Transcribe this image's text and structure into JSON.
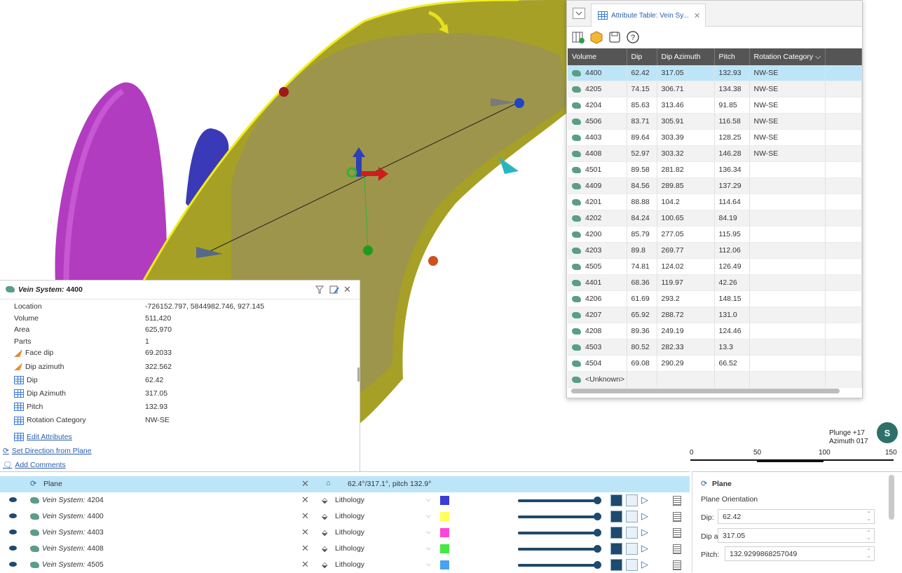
{
  "viewport": {
    "plunge_label": "Plunge +17",
    "azimuth_label": "Azimuth 017",
    "compass_letter": "S",
    "scale_ticks": [
      "0",
      "50",
      "100",
      "150"
    ]
  },
  "attribute_table": {
    "tab_title": "Attribute Table: Vein Sy...",
    "columns": [
      "Volume",
      "Dip",
      "Dip Azimuth",
      "Pitch",
      "Rotation Category"
    ],
    "rows": [
      [
        "4400",
        "62.42",
        "317.05",
        "132.93",
        "NW-SE"
      ],
      [
        "4205",
        "74.15",
        "306.71",
        "134.38",
        "NW-SE"
      ],
      [
        "4204",
        "85.63",
        "313.46",
        "91.85",
        "NW-SE"
      ],
      [
        "4506",
        "83.71",
        "305.91",
        "116.58",
        "NW-SE"
      ],
      [
        "4403",
        "89.64",
        "303.39",
        "128.25",
        "NW-SE"
      ],
      [
        "4408",
        "52.97",
        "303.32",
        "146.28",
        "NW-SE"
      ],
      [
        "4501",
        "89.58",
        "281.82",
        "136.34",
        ""
      ],
      [
        "4409",
        "84.56",
        "289.85",
        "137.29",
        ""
      ],
      [
        "4201",
        "88.88",
        "104.2",
        "114.64",
        ""
      ],
      [
        "4202",
        "84.24",
        "100.65",
        "84.19",
        ""
      ],
      [
        "4200",
        "85.79",
        "277.05",
        "115.95",
        ""
      ],
      [
        "4203",
        "89.8",
        "269.77",
        "112.06",
        ""
      ],
      [
        "4505",
        "74.81",
        "124.02",
        "126.49",
        ""
      ],
      [
        "4401",
        "68.36",
        "119.97",
        "42.26",
        ""
      ],
      [
        "4206",
        "61.69",
        "293.2",
        "148.15",
        ""
      ],
      [
        "4207",
        "65.92",
        "288.72",
        "131.0",
        ""
      ],
      [
        "4208",
        "89.36",
        "249.19",
        "124.46",
        ""
      ],
      [
        "4503",
        "80.52",
        "282.33",
        "13.3",
        ""
      ],
      [
        "4504",
        "69.08",
        "290.29",
        "66.52",
        ""
      ],
      [
        "<Unknown>",
        "",
        "",
        "",
        ""
      ]
    ]
  },
  "properties": {
    "title_prefix": "Vein System:",
    "title_id": "4400",
    "fields": [
      {
        "label": "Location",
        "value": "-726152.797, 5844982.746, 927.145",
        "icon": ""
      },
      {
        "label": "Volume",
        "value": "511,420",
        "icon": ""
      },
      {
        "label": "Area",
        "value": "625,970",
        "icon": ""
      },
      {
        "label": "Parts",
        "value": "1",
        "icon": ""
      },
      {
        "label": "Face dip",
        "value": "69.2033",
        "icon": "dip-icon"
      },
      {
        "label": "Dip azimuth",
        "value": "322.562",
        "icon": "dip-icon"
      },
      {
        "label": "Dip",
        "value": "62.42",
        "icon": "table-icon"
      },
      {
        "label": "Dip Azimuth",
        "value": "317.05",
        "icon": "table-icon"
      },
      {
        "label": "Pitch",
        "value": "132.93",
        "icon": "table-icon"
      },
      {
        "label": "Rotation Category",
        "value": "NW-SE",
        "icon": "table-icon"
      }
    ],
    "links": {
      "edit": "Edit Attributes",
      "set_direction": "Set Direction from Plane",
      "add_comments": "Add Comments"
    }
  },
  "scene_list": {
    "header": {
      "name": "Plane",
      "orientation": "62.4°/317.1°, pitch 132.9°"
    },
    "rows": [
      {
        "prefix": "Vein System:",
        "id": "4204",
        "lith": "Lithology",
        "color": "#3b3bd6"
      },
      {
        "prefix": "Vein System:",
        "id": "4400",
        "lith": "Lithology",
        "color": "#ffff5a"
      },
      {
        "prefix": "Vein System:",
        "id": "4403",
        "lith": "Lithology",
        "color": "#ff44d8"
      },
      {
        "prefix": "Vein System:",
        "id": "4408",
        "lith": "Lithology",
        "color": "#44e844"
      },
      {
        "prefix": "Vein System:",
        "id": "4505",
        "lith": "Lithology",
        "color": "#4aa3f0"
      }
    ]
  },
  "plane_panel": {
    "title": "Plane",
    "section": "Plane Orientation",
    "dip_label": "Dip:",
    "dip_value": "62.42",
    "dipaz_label": "Dip az:",
    "dipaz_value": "317.05",
    "pitch_label": "Pitch:",
    "pitch_value": "132.9299868257049"
  }
}
